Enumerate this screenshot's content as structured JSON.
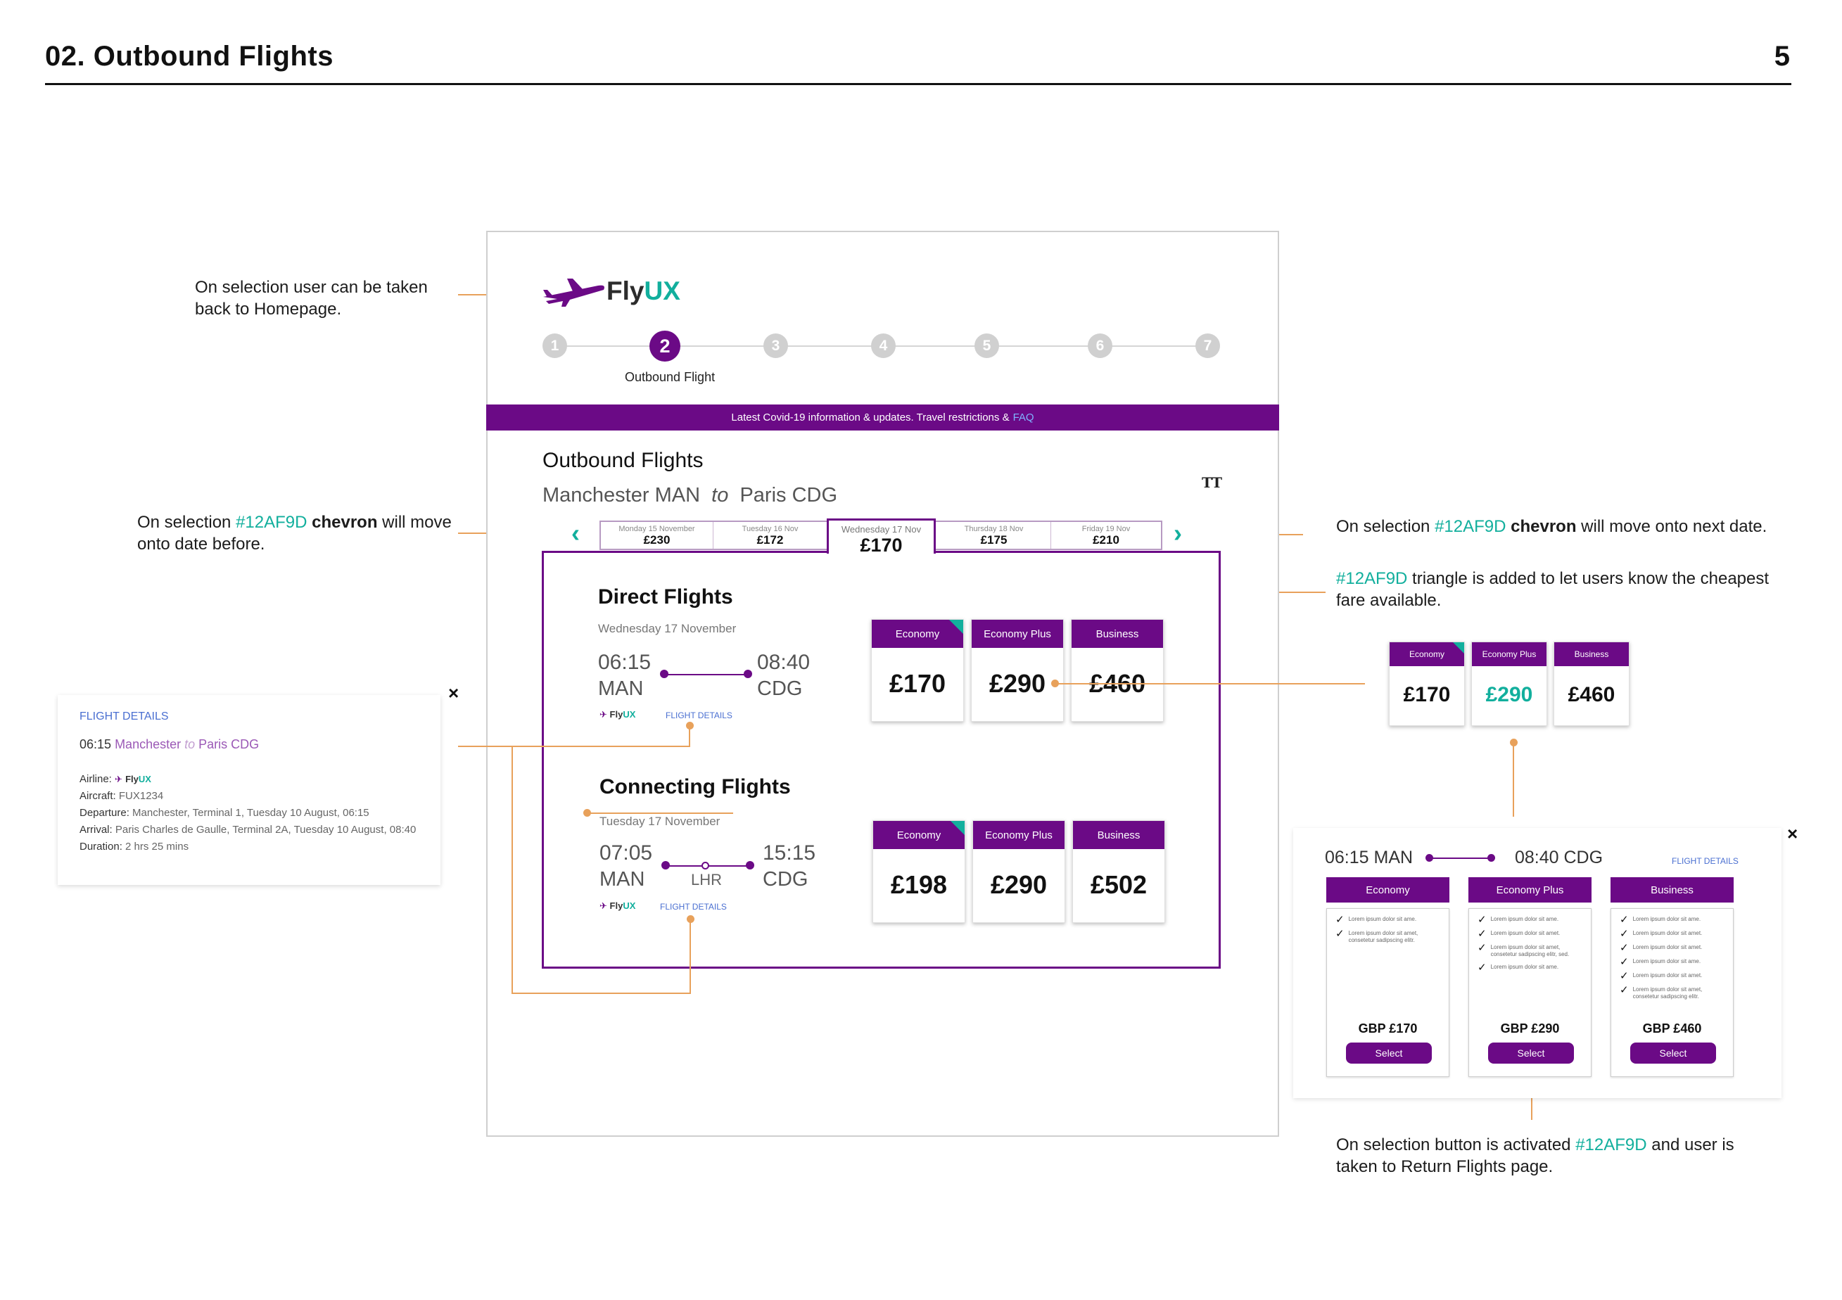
{
  "page": {
    "title": "02. Outbound Flights",
    "number": "5"
  },
  "annotations": {
    "homepage": {
      "line1": "On selection user can be taken",
      "line2": "back to Homepage."
    },
    "prev": {
      "a": "On selection ",
      "color": "#12AF9D",
      "b": " chevron",
      "c": " will move",
      "line2": "onto date before."
    },
    "next": {
      "a": "On selection ",
      "color": "#12AF9D",
      "b": " chevron",
      "c": " will move onto next date."
    },
    "triangle": {
      "color": "#12AF9D",
      "a": " triangle is added to let users know the cheapest",
      "line2": "fare available."
    },
    "select": {
      "a": "On selection button is activated ",
      "color": "#12AF9D",
      "b": " and user is",
      "line2": "taken to Return Flights page."
    }
  },
  "brand": {
    "fly": "Fly",
    "ux": "UX"
  },
  "steps": {
    "labels": [
      "1",
      "2",
      "3",
      "4",
      "5",
      "6",
      "7"
    ],
    "active_label": "Outbound Flight"
  },
  "covid": {
    "text": "Latest Covid-19 information & updates. Travel restrictions & ",
    "faq": "FAQ"
  },
  "outbound": {
    "title": "Outbound Flights",
    "from": "Manchester MAN",
    "to_word": "to",
    "to": "Paris CDG",
    "text_size_icon": "TT"
  },
  "dates": [
    {
      "day": "Monday 15 November",
      "price": "£230"
    },
    {
      "day": "Tuesday 16 Nov",
      "price": "£172"
    },
    {
      "day": "Wednesday 17 Nov",
      "price": "£170"
    },
    {
      "day": "Thursday 18 Nov",
      "price": "£175"
    },
    {
      "day": "Friday 19 Nov",
      "price": "£210"
    }
  ],
  "direct": {
    "title": "Direct Flights",
    "date": "Wednesday 17 November",
    "dep_time": "06:15",
    "dep_code": "MAN",
    "arr_time": "08:40",
    "arr_code": "CDG",
    "details_link": "FLIGHT DETAILS",
    "fares": [
      {
        "class": "Economy",
        "price": "£170"
      },
      {
        "class": "Economy Plus",
        "price": "£290"
      },
      {
        "class": "Business",
        "price": "£460"
      }
    ]
  },
  "connecting": {
    "title": "Connecting Flights",
    "date": "Tuesday 17 November",
    "dep_time": "07:05",
    "dep_code": "MAN",
    "via": "LHR",
    "arr_time": "15:15",
    "arr_code": "CDG",
    "details_link": "FLIGHT DETAILS",
    "fares": [
      {
        "class": "Economy",
        "price": "£198"
      },
      {
        "class": "Economy Plus",
        "price": "£290"
      },
      {
        "class": "Business",
        "price": "£502"
      }
    ]
  },
  "flight_details": {
    "title": "FLIGHT DETAILS",
    "time": "06:15",
    "from": "Manchester",
    "to_word": "to",
    "to": "Paris CDG",
    "airline_label": "Airline:",
    "aircraft_label": "Aircraft:",
    "aircraft": "FUX1234",
    "departure_label": "Departure:",
    "departure": "Manchester, Terminal 1, Tuesday 10 August, 06:15",
    "arrival_label": "Arrival:",
    "arrival": "Paris Charles de Gaulle, Terminal 2A, Tuesday 10 August, 08:40",
    "duration_label": "Duration:",
    "duration": "2 hrs 25 mins",
    "close": "×"
  },
  "hover_fares": [
    {
      "class": "Economy",
      "price": "£170"
    },
    {
      "class": "Economy Plus",
      "price": "£290"
    },
    {
      "class": "Business",
      "price": "£460"
    }
  ],
  "expanded": {
    "dep": "06:15 MAN",
    "arr": "08:40 CDG",
    "details_link": "FLIGHT DETAILS",
    "close": "×",
    "columns": [
      {
        "class": "Economy",
        "gbp": "GBP £170",
        "button": "Select",
        "items": [
          "Lorem ipsum dolor sit ame.",
          "Lorem ipsum dolor sit amet, consetetur sadipscing elitr."
        ]
      },
      {
        "class": "Economy Plus",
        "gbp": "GBP £290",
        "button": "Select",
        "items": [
          "Lorem ipsum dolor sit ame.",
          "Lorem ipsum dolor sit amet.",
          "Lorem ipsum dolor sit amet, consetetur sadipscing elitr, sed.",
          "Lorem ipsum dolor sit ame."
        ]
      },
      {
        "class": "Business",
        "gbp": "GBP £460",
        "button": "Select",
        "items": [
          "Lorem ipsum dolor sit ame.",
          "Lorem ipsum dolor sit amet.",
          "Lorem ipsum dolor sit amet.",
          "Lorem ipsum dolor sit ame.",
          "Lorem ipsum dolor sit amet.",
          "Lorem ipsum dolor sit amet, consetetur sadipscing elitr."
        ]
      }
    ]
  },
  "colors": {
    "brand_purple": "#6B0A86",
    "accent_green": "#12AF9D",
    "annotation_orange": "#E8A15B"
  }
}
